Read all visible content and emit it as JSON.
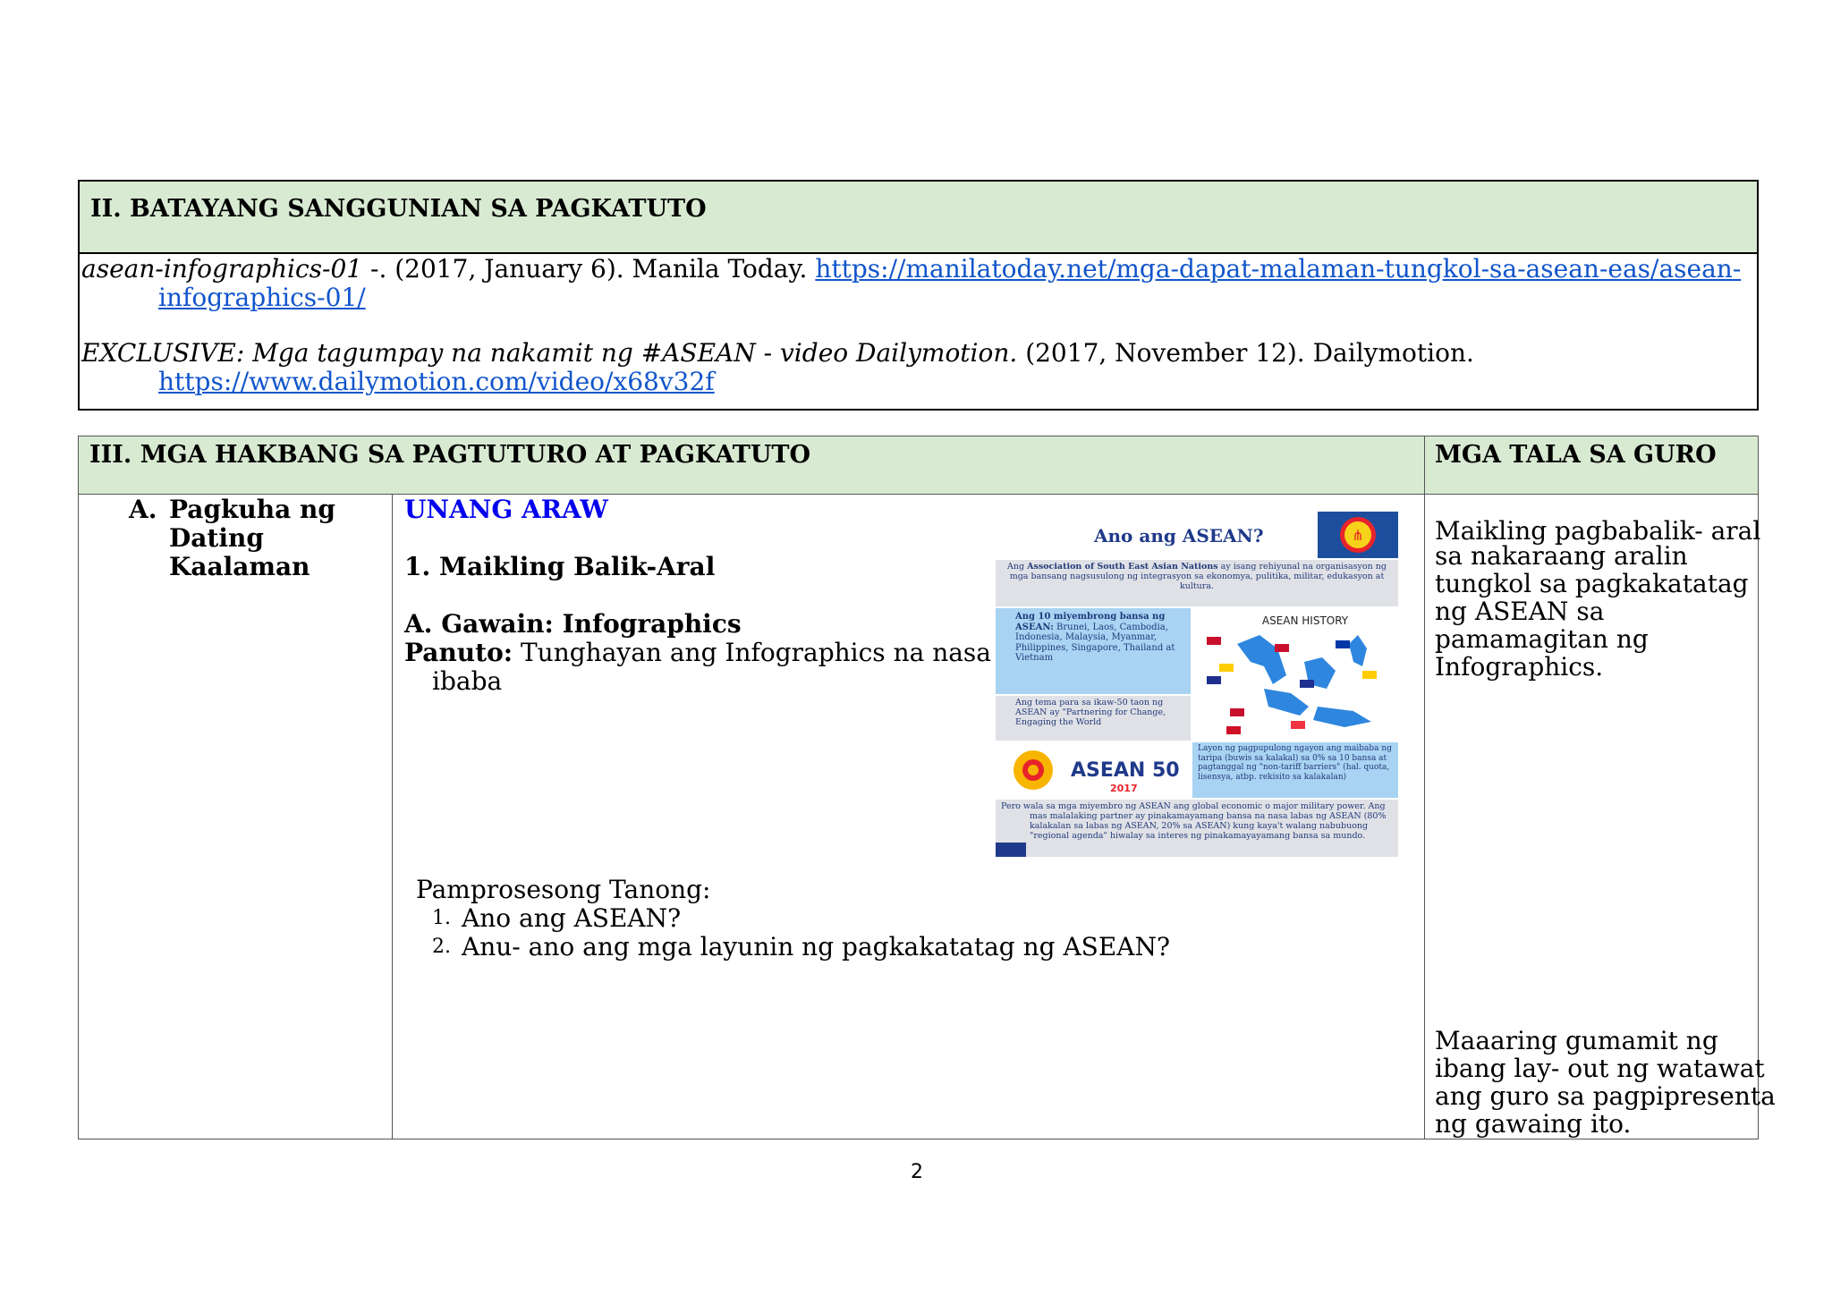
{
  "section2": {
    "header": "II. BATAYANG SANGGUNIAN SA PAGKATUTO",
    "ref1": {
      "title": "asean-infographics-01",
      "rest": " -. (2017, January 6). Manila Today. ",
      "url_line1": "https://manilatoday.net/mga-dapat-malaman-tungkol-sa-asean-eas/asean-",
      "url_line2": "infographics-01/"
    },
    "ref2": {
      "title": "EXCLUSIVE: Mga tagumpay na nakamit ng #ASEAN - video Dailymotion.",
      "rest": " (2017, November 12). Dailymotion.",
      "url": "https://www.dailymotion.com/video/x68v32f"
    }
  },
  "section3": {
    "header_left": "III. MGA HAKBANG SA PAGTUTURO AT PAGKATUTO",
    "header_right": "MGA TALA SA GURO",
    "step_letter": "A.",
    "step_label_lines": [
      "Pagkuha ng",
      "Dating",
      "Kaalaman"
    ],
    "day_label": "UNANG ARAW",
    "subheading": "1. Maikling Balik-Aral",
    "activity": "A. Gawain: Infographics",
    "panuto_label": "Panuto:",
    "panuto_line1": " Tunghayan  ang  Infographics  na  nasa",
    "panuto_line2": "ibaba",
    "questions_label": "Pamprosesong Tanong:",
    "questions": [
      "Ano ang ASEAN?",
      "Anu- ano ang mga layunin ng pagkakatatag ng ASEAN?"
    ],
    "note1_lines": [
      "Maikling pagbabalik- aral",
      "sa nakaraang aralin",
      "tungkol sa pagkakatatag",
      "ng ASEAN sa",
      "pamamagitan ng",
      "Infographics."
    ],
    "note2_lines": [
      "Maaaring gumamit ng",
      "ibang lay- out ng watawat",
      "ang guro sa pagpipresenta",
      "ng gawaing ito."
    ]
  },
  "infographic": {
    "title": "Ano ang ASEAN?",
    "intro_pre": "Ang ",
    "intro_bold": "Association of South East Asian Nations",
    "intro_post": " ay isang rehiyunal na organisasyon ng mga bansang nagsusulong ng integrasyon sa ekonomya, pulitika, militar, edukasyon at kultura.",
    "members_bold": "Ang 10 miyembrong bansa ng ASEAN:",
    "members": " Brunei, Laos, Cambodia, Indonesia, Malaysia, Myanmar, Philippines, Singapore, Thailand at Vietnam",
    "history_label": "ASEAN HISTORY",
    "theme": "Ang tema para sa ikaw-50 taon ng ASEAN ay \"Partnering for Change, Engaging the World",
    "logo_text": "ASEAN 50",
    "logo_year": "2017",
    "tariff": "Layon ng pagpupulong ngayon ang maibaba ng taripa (buwis sa kalakal) sa 0% sa 10 bansa at pagtanggal ng \"non-tariff barriers\" (hal. quota, lisensya, atbp. rekisito sa kalakalan)",
    "footer": "Pero wala sa mga miyembro ng ASEAN ang global economic o major military power. Ang mas malalaking partner ay pinakamayamang bansa na nasa labas ng ASEAN (80% kalakalan sa labas ng ASEAN, 20% sa ASEAN) kung kaya't walang nabubuong \"regional agenda\" hiwalay sa interes ng pinakamayayamang bansa sa mundo."
  },
  "page_number": "2",
  "colors": {
    "header_bg": "#d9ead3",
    "link": "#1155cc",
    "day_label": "#0000ee"
  }
}
